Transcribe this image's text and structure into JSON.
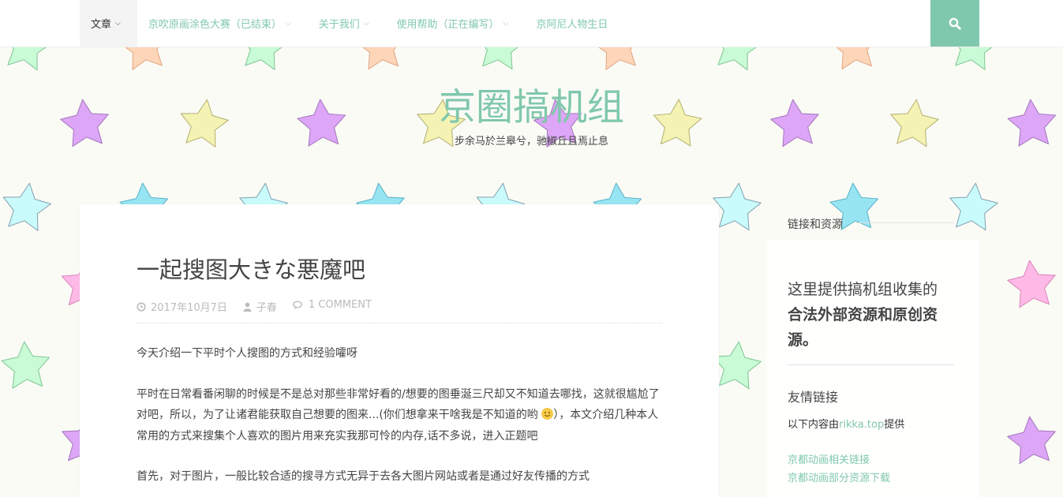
{
  "nav": {
    "items": [
      {
        "label": "文章",
        "dropdown": true
      },
      {
        "label": "京吹原画涂色大赛（已结束）",
        "dropdown": true
      },
      {
        "label": "关于我们",
        "dropdown": true
      },
      {
        "label": "使用帮助（正在编写）",
        "dropdown": true
      },
      {
        "label": "京阿尼人物生日",
        "dropdown": false
      }
    ],
    "search_icon": "search-icon"
  },
  "site": {
    "title": "京圈搞机组",
    "description": "步余马於兰皋兮，驰椒丘且焉止息"
  },
  "post": {
    "title": "一起搜图大きな悪魔吧",
    "date": "2017年10月7日",
    "author": "子春",
    "comments": "1 COMMENT",
    "para1": "今天介绍一下平时个人搜图的方式和经验嚯呀",
    "para2_a": "平时在日常看番闲聊的时候是不是总对那些非常好看的/想要的图垂涎三尺却又不知道去哪找，这就很尴尬了对吧，所以，为了让诸君能获取自己想要的图来...(你们想拿来干啥我是不知道的哟 ",
    "para2_b": "），本文介绍几种本人常用的方式来搜集个人喜欢的图片用来充实我那可怜的内存,话不多说，进入正题吧",
    "para3": "首先，对于图片，一般比较合适的搜寻方式无异于去各大图片网站或者是通过好友传播的方式"
  },
  "sidebar": {
    "links_heading": "链接和资源",
    "intro_plain": "这里提供搞机组收集的",
    "intro_bold": "合法外部资源和原创资源。",
    "friends_heading": "友情链接",
    "provided_prefix": "以下内容由",
    "provided_link": "rikka.top",
    "provided_suffix": "提供",
    "links": [
      "京都动画相关链接",
      "京都动画部分资源下载"
    ]
  },
  "colors": {
    "accent": "#80c8ad",
    "text": "#444444",
    "meta": "#bbbbbb",
    "star_pink": "#ffb9e6",
    "star_purple": "#dda6f7",
    "star_yellow": "#f5f3b4",
    "star_green": "#c9fbd7",
    "star_peach": "#fdd6b9",
    "star_cyan": "#c9fbfc",
    "star_blue": "#97e4f3"
  }
}
